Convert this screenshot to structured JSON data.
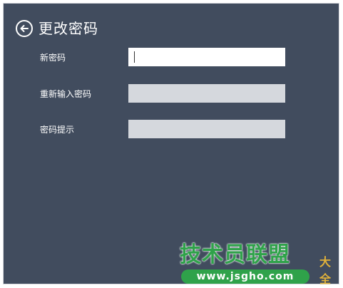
{
  "header": {
    "title": "更改密码",
    "back_icon": "arrow-left-circle-icon"
  },
  "form": {
    "fields": [
      {
        "label": "新密码",
        "value": "",
        "active": true
      },
      {
        "label": "重新输入密码",
        "value": "",
        "active": false
      },
      {
        "label": "密码提示",
        "value": "",
        "active": false
      }
    ]
  },
  "watermark": {
    "title": "技术员联盟",
    "extra": "大全",
    "url": "www.jsgho.com"
  },
  "colors": {
    "background": "#414c5e",
    "input_active": "#ffffff",
    "input_inactive": "#d5d8dd",
    "watermark_green": "#2fa24a"
  }
}
